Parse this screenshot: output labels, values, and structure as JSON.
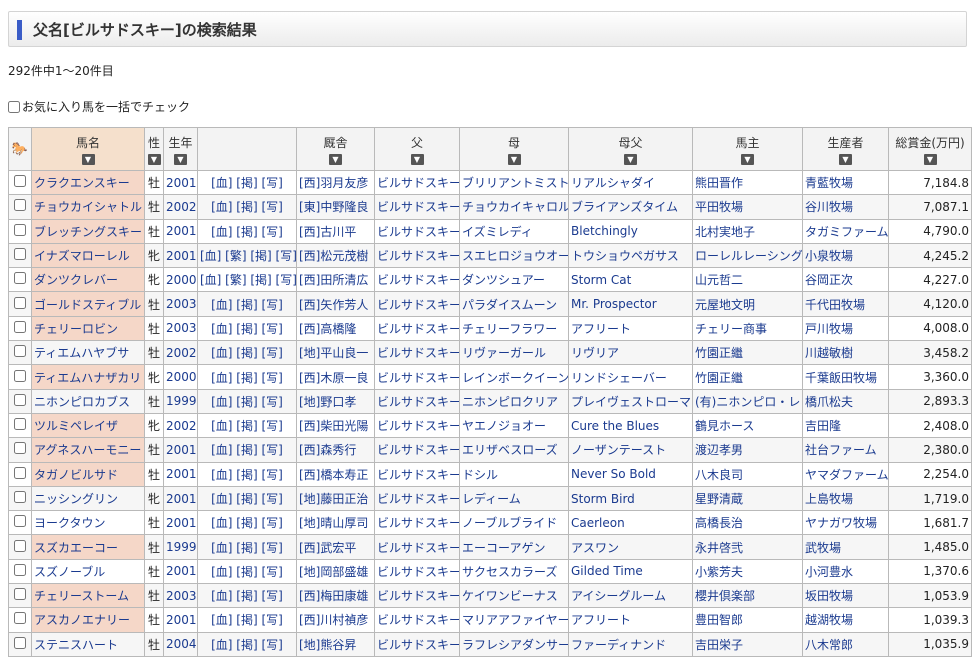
{
  "page_title": "父名[ビルサドスキー]の検索結果",
  "result_count": "292件中1～20件目",
  "check_all_label": "お気に入り馬を一括でチェック",
  "headers": {
    "name": "馬名",
    "sex": "性",
    "year": "生年",
    "stable": "厩舎",
    "sire": "父",
    "dam": "母",
    "damsire": "母父",
    "owner": "馬主",
    "breeder": "生産者",
    "prize": "総賞金(万円)",
    "sort": "▼"
  },
  "rows": [
    {
      "name": "クラクエンスキー",
      "sex": "牡",
      "year": "2001",
      "links": "[血] [掲] [写]",
      "stable": "[西]羽月友彦",
      "sire": "ビルサドスキー",
      "dam": "ブリリアントミスト",
      "damsire": "リアルシャダイ",
      "owner": "熊田晋作",
      "breeder": "青藍牧場",
      "prize": "7,184.8",
      "hl": true
    },
    {
      "name": "チョウカイシャトル",
      "sex": "牡",
      "year": "2002",
      "links": "[血] [掲] [写]",
      "stable": "[東]中野隆良",
      "sire": "ビルサドスキー",
      "dam": "チョウカイキャロル",
      "damsire": "ブライアンズタイム",
      "owner": "平田牧場",
      "breeder": "谷川牧場",
      "prize": "7,087.1",
      "hl": true
    },
    {
      "name": "ブレッチングスキー",
      "sex": "牡",
      "year": "2001",
      "links": "[血] [掲] [写]",
      "stable": "[西]古川平",
      "sire": "ビルサドスキー",
      "dam": "イズミレディ",
      "damsire": "Bletchingly",
      "owner": "北村実地子",
      "breeder": "タガミファーム",
      "prize": "4,790.0",
      "hl": true
    },
    {
      "name": "イナズマローレル",
      "sex": "牝",
      "year": "2001",
      "links": "[血] [繁] [掲] [写]",
      "stable": "[西]松元茂樹",
      "sire": "ビルサドスキー",
      "dam": "スエヒロジョウオー",
      "damsire": "トウショウペガサス",
      "owner": "ローレルレーシング",
      "breeder": "小泉牧場",
      "prize": "4,245.2",
      "hl": true
    },
    {
      "name": "ダンツクレバー",
      "sex": "牝",
      "year": "2000",
      "links": "[血] [繁] [掲] [写]",
      "stable": "[西]田所清広",
      "sire": "ビルサドスキー",
      "dam": "ダンツシュアー",
      "damsire": "Storm Cat",
      "owner": "山元哲二",
      "breeder": "谷岡正次",
      "prize": "4,227.0",
      "hl": true
    },
    {
      "name": "ゴールドスティブル",
      "sex": "牡",
      "year": "2003",
      "links": "[血] [掲] [写]",
      "stable": "[西]矢作芳人",
      "sire": "ビルサドスキー",
      "dam": "パラダイスムーン",
      "damsire": "Mr. Prospector",
      "owner": "元屋地文明",
      "breeder": "千代田牧場",
      "prize": "4,120.0",
      "hl": true
    },
    {
      "name": "チェリーロビン",
      "sex": "牡",
      "year": "2003",
      "links": "[血] [掲] [写]",
      "stable": "[西]高橋隆",
      "sire": "ビルサドスキー",
      "dam": "チェリーフラワー",
      "damsire": "アフリート",
      "owner": "チェリー商事",
      "breeder": "戸川牧場",
      "prize": "4,008.0",
      "hl": true
    },
    {
      "name": "ティエムハヤブサ",
      "sex": "牡",
      "year": "2002",
      "links": "[血] [掲] [写]",
      "stable": "[地]平山良一",
      "sire": "ビルサドスキー",
      "dam": "リヴァーガール",
      "damsire": "リヴリア",
      "owner": "竹園正繼",
      "breeder": "川越敏樹",
      "prize": "3,458.2",
      "hl": false
    },
    {
      "name": "ティエムハナザカリ",
      "sex": "牝",
      "year": "2000",
      "links": "[血] [掲] [写]",
      "stable": "[西]木原一良",
      "sire": "ビルサドスキー",
      "dam": "レインボークイーン",
      "damsire": "リンドシェーバー",
      "owner": "竹園正繼",
      "breeder": "千葉飯田牧場",
      "prize": "3,360.0",
      "hl": true
    },
    {
      "name": "ニホンピロカブス",
      "sex": "牡",
      "year": "1999",
      "links": "[血] [掲] [写]",
      "stable": "[地]野口孝",
      "sire": "ビルサドスキー",
      "dam": "ニホンピロクリア",
      "damsire": "プレイヴェストローマン",
      "owner": "(有)ニホンピロ・レ",
      "breeder": "橋爪松夫",
      "prize": "2,893.3",
      "hl": false
    },
    {
      "name": "ツルミペレイザ",
      "sex": "牝",
      "year": "2002",
      "links": "[血] [掲] [写]",
      "stable": "[西]柴田光陽",
      "sire": "ビルサドスキー",
      "dam": "ヤエノジョオー",
      "damsire": "Cure the Blues",
      "owner": "鶴見ホース",
      "breeder": "吉田隆",
      "prize": "2,408.0",
      "hl": true
    },
    {
      "name": "アグネスハーモニー",
      "sex": "牡",
      "year": "2001",
      "links": "[血] [掲] [写]",
      "stable": "[西]森秀行",
      "sire": "ビルサドスキー",
      "dam": "エリザベスローズ",
      "damsire": "ノーザンテースト",
      "owner": "渡辺孝男",
      "breeder": "社台ファーム",
      "prize": "2,380.0",
      "hl": true
    },
    {
      "name": "タガノビルサド",
      "sex": "牡",
      "year": "2001",
      "links": "[血] [掲] [写]",
      "stable": "[西]橋本寿正",
      "sire": "ビルサドスキー",
      "dam": "ドシル",
      "damsire": "Never So Bold",
      "owner": "八木良司",
      "breeder": "ヤマダファーム",
      "prize": "2,254.0",
      "hl": true
    },
    {
      "name": "ニッシングリン",
      "sex": "牝",
      "year": "2001",
      "links": "[血] [掲] [写]",
      "stable": "[地]藤田正治",
      "sire": "ビルサドスキー",
      "dam": "レディーム",
      "damsire": "Storm Bird",
      "owner": "星野清蔵",
      "breeder": "上島牧場",
      "prize": "1,719.0",
      "hl": false
    },
    {
      "name": "ヨークタウン",
      "sex": "牡",
      "year": "2001",
      "links": "[血] [掲] [写]",
      "stable": "[地]晴山厚司",
      "sire": "ビルサドスキー",
      "dam": "ノーブルブライド",
      "damsire": "Caerleon",
      "owner": "高橋長治",
      "breeder": "ヤナガワ牧場",
      "prize": "1,681.7",
      "hl": false
    },
    {
      "name": "スズカエーコー",
      "sex": "牡",
      "year": "1999",
      "links": "[血] [掲] [写]",
      "stable": "[西]武宏平",
      "sire": "ビルサドスキー",
      "dam": "エーコーアゲン",
      "damsire": "アスワン",
      "owner": "永井啓弐",
      "breeder": "武牧場",
      "prize": "1,485.0",
      "hl": true
    },
    {
      "name": "スズノーブル",
      "sex": "牡",
      "year": "2001",
      "links": "[血] [掲] [写]",
      "stable": "[地]岡部盛雄",
      "sire": "ビルサドスキー",
      "dam": "サクセスカラーズ",
      "damsire": "Gilded Time",
      "owner": "小紫芳夫",
      "breeder": "小河豊水",
      "prize": "1,370.6",
      "hl": false
    },
    {
      "name": "チェリーストーム",
      "sex": "牡",
      "year": "2003",
      "links": "[血] [掲] [写]",
      "stable": "[西]梅田康雄",
      "sire": "ビルサドスキー",
      "dam": "ケイワンビーナス",
      "damsire": "アイシーグルーム",
      "owner": "櫻井倶楽部",
      "breeder": "坂田牧場",
      "prize": "1,053.9",
      "hl": true
    },
    {
      "name": "アスカノエナリー",
      "sex": "牡",
      "year": "2001",
      "links": "[血] [掲] [写]",
      "stable": "[西]川村禎彦",
      "sire": "ビルサドスキー",
      "dam": "マリアアファイヤー",
      "damsire": "アフリート",
      "owner": "豊田智郎",
      "breeder": "越湖牧場",
      "prize": "1,039.3",
      "hl": true
    },
    {
      "name": "ステニスハート",
      "sex": "牡",
      "year": "2004",
      "links": "[血] [掲] [写]",
      "stable": "[地]熊谷昇",
      "sire": "ビルサドスキー",
      "dam": "ラフレシアダンサー",
      "damsire": "ファーディナンド",
      "owner": "吉田栄子",
      "breeder": "八木常郎",
      "prize": "1,035.9",
      "hl": false
    }
  ]
}
